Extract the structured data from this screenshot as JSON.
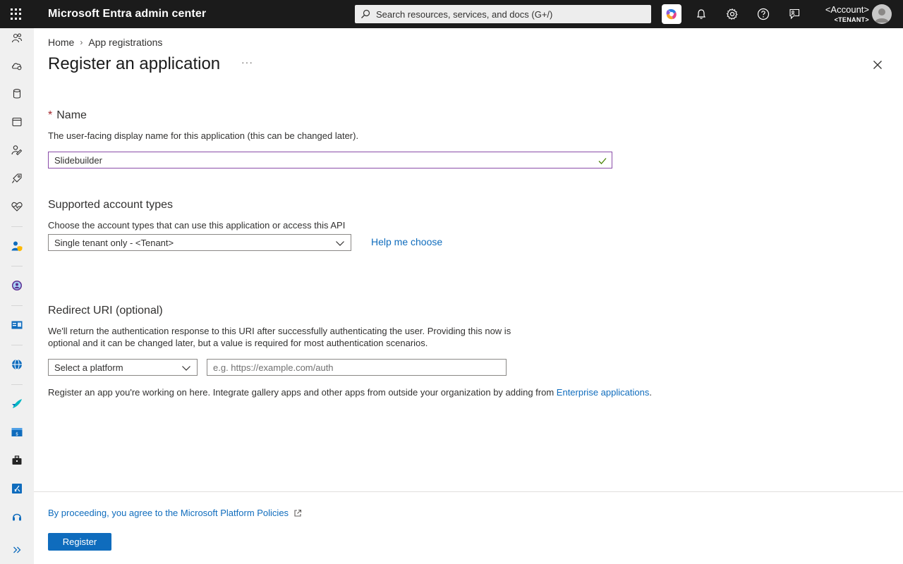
{
  "header": {
    "app_title": "Microsoft Entra admin center",
    "search_placeholder": "Search resources, services, and docs (G+/)",
    "account_name": "<Account>",
    "tenant_name": "<TENANT>",
    "icons": [
      "app-launcher-icon",
      "search-icon",
      "copilot-icon",
      "bell-icon",
      "gear-icon",
      "help-icon",
      "feedback-icon",
      "avatar"
    ]
  },
  "rail": {
    "items": [
      "users-icon",
      "cloud-icon",
      "database-icon",
      "calendar-icon",
      "identity-icon",
      "rocket-icon",
      "heart-icon",
      "user-shield-icon",
      "identity-protection-icon",
      "id-card-icon",
      "globe-icon",
      "plane-icon",
      "billing-icon",
      "briefcase-icon",
      "app-store-icon",
      "support-icon",
      "expand-icon"
    ]
  },
  "breadcrumb": {
    "home": "Home",
    "separator": "›",
    "current": "App registrations"
  },
  "page": {
    "title": "Register an application",
    "more": "···"
  },
  "name_section": {
    "required_mark": "*",
    "label": "Name",
    "description": "The user-facing display name for this application (this can be changed later).",
    "value": "Slidebuilder"
  },
  "account_types": {
    "label": "Supported account types",
    "description": "Choose the account types that can use this application or access this API",
    "selected": "Single tenant only - <Tenant>",
    "help_link": "Help me choose"
  },
  "redirect": {
    "label": "Redirect URI (optional)",
    "description_line1": "We'll return the authentication response to this URI after successfully authenticating the user. Providing this now is",
    "description_line2": "optional and it can be changed later, but a value is required for most authentication scenarios.",
    "platform_placeholder": "Select a platform",
    "uri_placeholder": "e.g. https://example.com/auth"
  },
  "note": {
    "text": "Register an app you're working on here. Integrate gallery apps and other apps from outside your organization by adding from ",
    "link": "Enterprise applications",
    "end": "."
  },
  "footer": {
    "policy_link": "By proceeding, you agree to the Microsoft Platform Policies",
    "register_label": "Register"
  },
  "colors": {
    "topbar": "#1b1b1b",
    "accent": "#0f6cbd",
    "input_focus": "#8a4ca8",
    "check": "#498205",
    "required": "#a4262c"
  }
}
